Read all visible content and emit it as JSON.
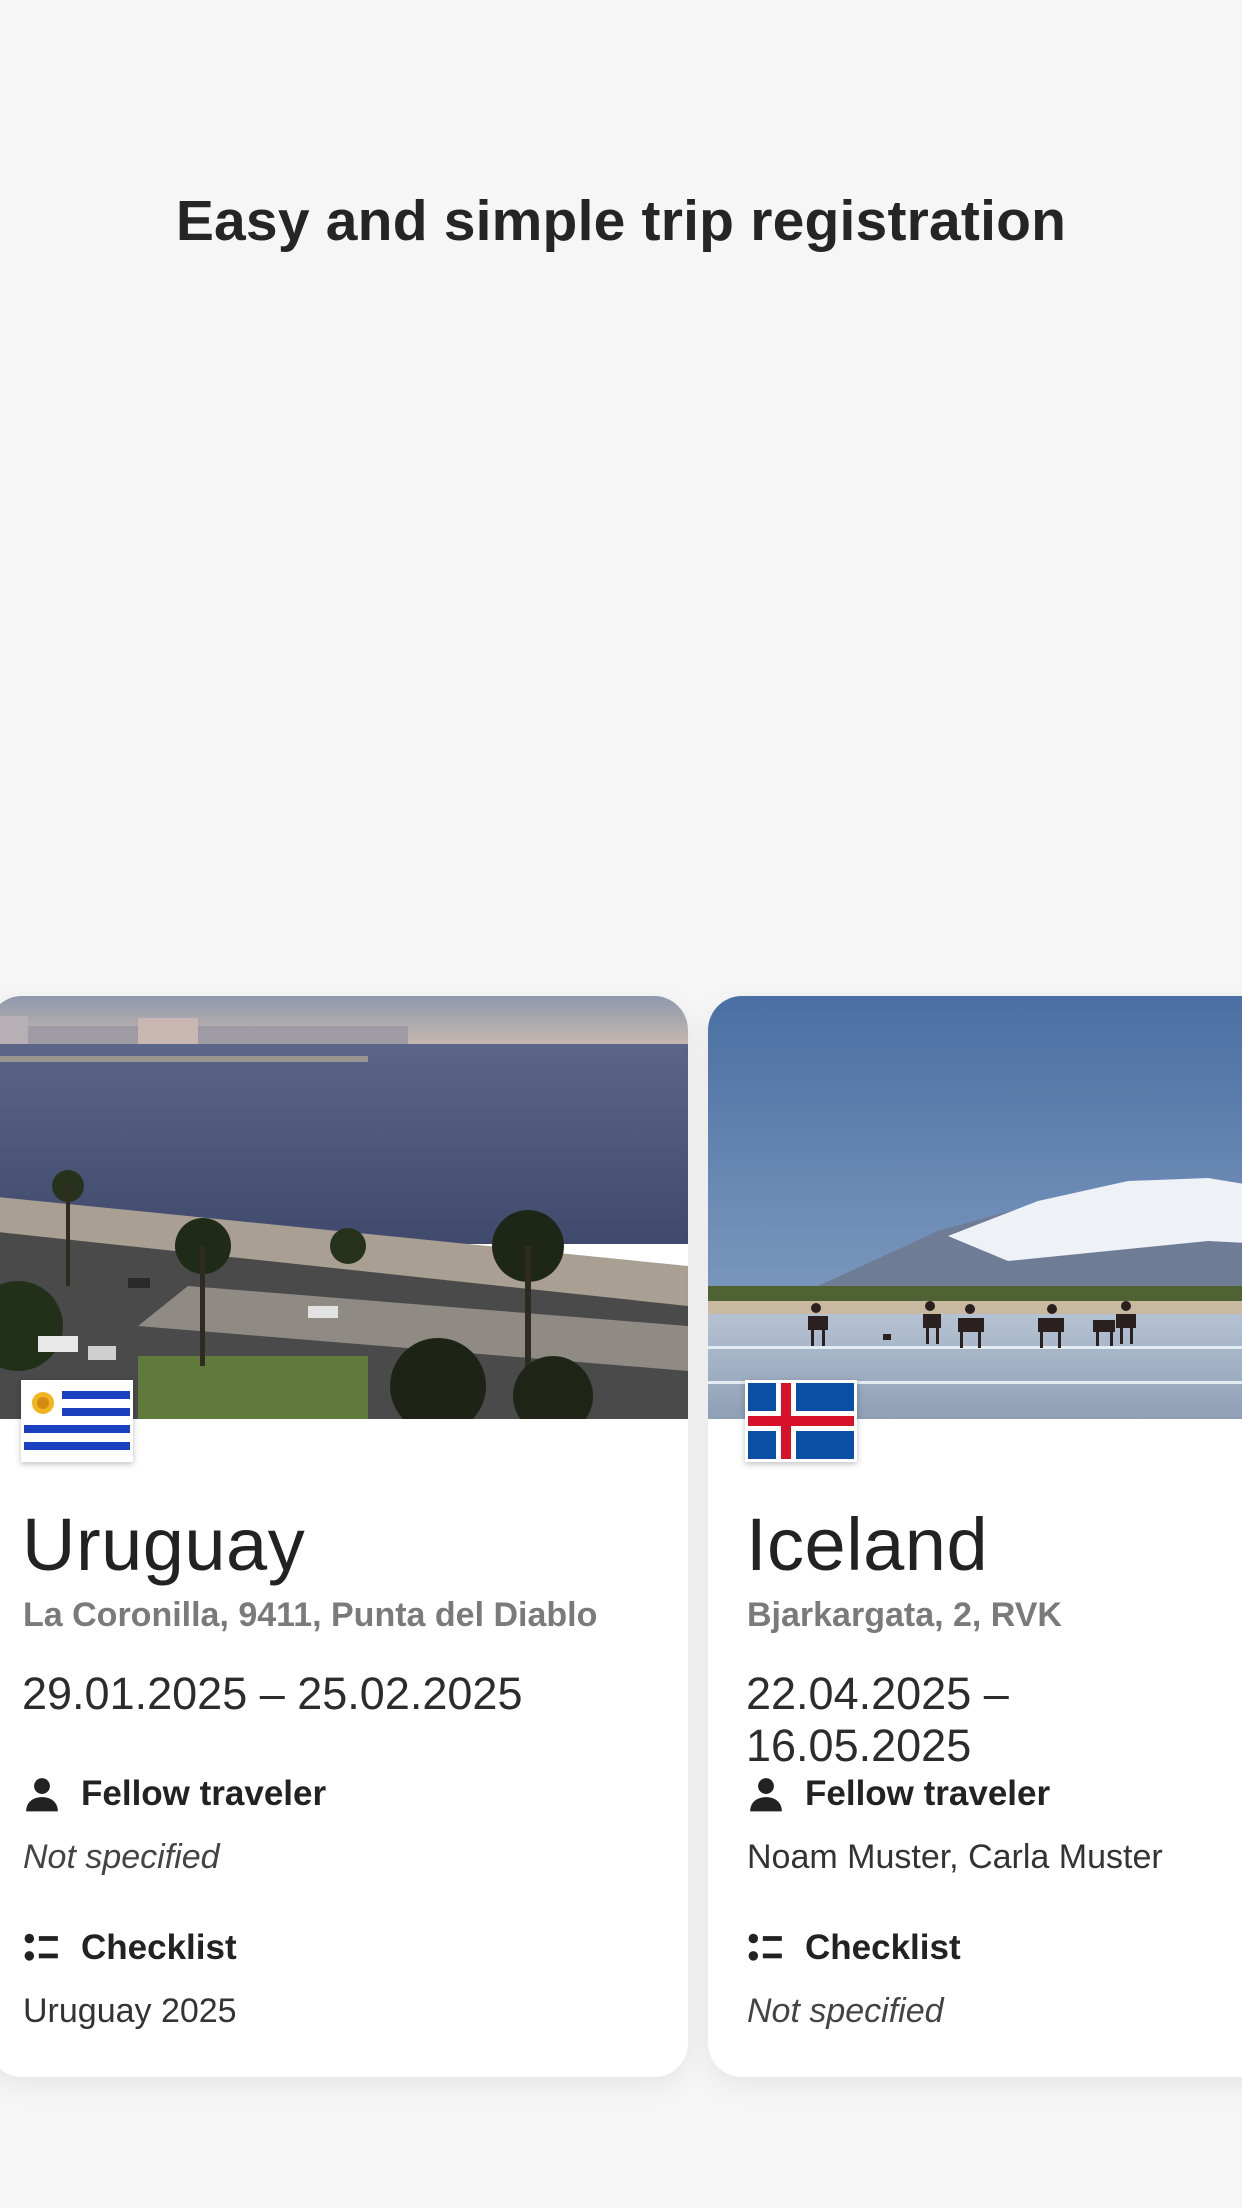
{
  "headline": "Easy and simple trip registration",
  "trips": [
    {
      "country": "Uruguay",
      "address": "La Coronilla, 9411, Punta del Diablo",
      "dates": "29.01.2025 – 25.02.2025",
      "fellow_traveler_label": "Fellow traveler",
      "fellow_traveler_value": "Not specified",
      "checklist_label": "Checklist",
      "checklist_value": "Uruguay 2025",
      "flag": "uruguay-flag-icon"
    },
    {
      "country": "Iceland",
      "address": "Bjarkargata, 2, RVK",
      "dates": "22.04.2025 – 16.05.2025",
      "fellow_traveler_label": "Fellow traveler",
      "fellow_traveler_value": "Noam Muster, Carla Muster",
      "checklist_label": "Checklist",
      "checklist_value": "Not specified",
      "flag": "iceland-flag-icon"
    }
  ],
  "colors": {
    "background": "#f6f6f6",
    "card": "#ffffff",
    "text": "#222222",
    "muted": "#7a7a7a"
  }
}
